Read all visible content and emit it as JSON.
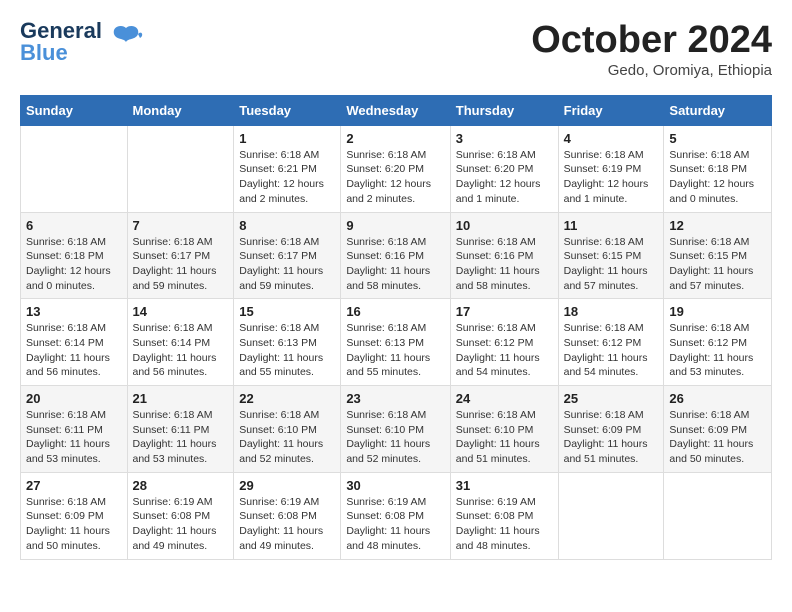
{
  "header": {
    "logo_line1": "General",
    "logo_line2": "Blue",
    "month_title": "October 2024",
    "location": "Gedo, Oromiya, Ethiopia"
  },
  "weekdays": [
    "Sunday",
    "Monday",
    "Tuesday",
    "Wednesday",
    "Thursday",
    "Friday",
    "Saturday"
  ],
  "weeks": [
    [
      {
        "day": "",
        "sunrise": "",
        "sunset": "",
        "daylight": ""
      },
      {
        "day": "",
        "sunrise": "",
        "sunset": "",
        "daylight": ""
      },
      {
        "day": "1",
        "sunrise": "Sunrise: 6:18 AM",
        "sunset": "Sunset: 6:21 PM",
        "daylight": "Daylight: 12 hours and 2 minutes."
      },
      {
        "day": "2",
        "sunrise": "Sunrise: 6:18 AM",
        "sunset": "Sunset: 6:20 PM",
        "daylight": "Daylight: 12 hours and 2 minutes."
      },
      {
        "day": "3",
        "sunrise": "Sunrise: 6:18 AM",
        "sunset": "Sunset: 6:20 PM",
        "daylight": "Daylight: 12 hours and 1 minute."
      },
      {
        "day": "4",
        "sunrise": "Sunrise: 6:18 AM",
        "sunset": "Sunset: 6:19 PM",
        "daylight": "Daylight: 12 hours and 1 minute."
      },
      {
        "day": "5",
        "sunrise": "Sunrise: 6:18 AM",
        "sunset": "Sunset: 6:18 PM",
        "daylight": "Daylight: 12 hours and 0 minutes."
      }
    ],
    [
      {
        "day": "6",
        "sunrise": "Sunrise: 6:18 AM",
        "sunset": "Sunset: 6:18 PM",
        "daylight": "Daylight: 12 hours and 0 minutes."
      },
      {
        "day": "7",
        "sunrise": "Sunrise: 6:18 AM",
        "sunset": "Sunset: 6:17 PM",
        "daylight": "Daylight: 11 hours and 59 minutes."
      },
      {
        "day": "8",
        "sunrise": "Sunrise: 6:18 AM",
        "sunset": "Sunset: 6:17 PM",
        "daylight": "Daylight: 11 hours and 59 minutes."
      },
      {
        "day": "9",
        "sunrise": "Sunrise: 6:18 AM",
        "sunset": "Sunset: 6:16 PM",
        "daylight": "Daylight: 11 hours and 58 minutes."
      },
      {
        "day": "10",
        "sunrise": "Sunrise: 6:18 AM",
        "sunset": "Sunset: 6:16 PM",
        "daylight": "Daylight: 11 hours and 58 minutes."
      },
      {
        "day": "11",
        "sunrise": "Sunrise: 6:18 AM",
        "sunset": "Sunset: 6:15 PM",
        "daylight": "Daylight: 11 hours and 57 minutes."
      },
      {
        "day": "12",
        "sunrise": "Sunrise: 6:18 AM",
        "sunset": "Sunset: 6:15 PM",
        "daylight": "Daylight: 11 hours and 57 minutes."
      }
    ],
    [
      {
        "day": "13",
        "sunrise": "Sunrise: 6:18 AM",
        "sunset": "Sunset: 6:14 PM",
        "daylight": "Daylight: 11 hours and 56 minutes."
      },
      {
        "day": "14",
        "sunrise": "Sunrise: 6:18 AM",
        "sunset": "Sunset: 6:14 PM",
        "daylight": "Daylight: 11 hours and 56 minutes."
      },
      {
        "day": "15",
        "sunrise": "Sunrise: 6:18 AM",
        "sunset": "Sunset: 6:13 PM",
        "daylight": "Daylight: 11 hours and 55 minutes."
      },
      {
        "day": "16",
        "sunrise": "Sunrise: 6:18 AM",
        "sunset": "Sunset: 6:13 PM",
        "daylight": "Daylight: 11 hours and 55 minutes."
      },
      {
        "day": "17",
        "sunrise": "Sunrise: 6:18 AM",
        "sunset": "Sunset: 6:12 PM",
        "daylight": "Daylight: 11 hours and 54 minutes."
      },
      {
        "day": "18",
        "sunrise": "Sunrise: 6:18 AM",
        "sunset": "Sunset: 6:12 PM",
        "daylight": "Daylight: 11 hours and 54 minutes."
      },
      {
        "day": "19",
        "sunrise": "Sunrise: 6:18 AM",
        "sunset": "Sunset: 6:12 PM",
        "daylight": "Daylight: 11 hours and 53 minutes."
      }
    ],
    [
      {
        "day": "20",
        "sunrise": "Sunrise: 6:18 AM",
        "sunset": "Sunset: 6:11 PM",
        "daylight": "Daylight: 11 hours and 53 minutes."
      },
      {
        "day": "21",
        "sunrise": "Sunrise: 6:18 AM",
        "sunset": "Sunset: 6:11 PM",
        "daylight": "Daylight: 11 hours and 53 minutes."
      },
      {
        "day": "22",
        "sunrise": "Sunrise: 6:18 AM",
        "sunset": "Sunset: 6:10 PM",
        "daylight": "Daylight: 11 hours and 52 minutes."
      },
      {
        "day": "23",
        "sunrise": "Sunrise: 6:18 AM",
        "sunset": "Sunset: 6:10 PM",
        "daylight": "Daylight: 11 hours and 52 minutes."
      },
      {
        "day": "24",
        "sunrise": "Sunrise: 6:18 AM",
        "sunset": "Sunset: 6:10 PM",
        "daylight": "Daylight: 11 hours and 51 minutes."
      },
      {
        "day": "25",
        "sunrise": "Sunrise: 6:18 AM",
        "sunset": "Sunset: 6:09 PM",
        "daylight": "Daylight: 11 hours and 51 minutes."
      },
      {
        "day": "26",
        "sunrise": "Sunrise: 6:18 AM",
        "sunset": "Sunset: 6:09 PM",
        "daylight": "Daylight: 11 hours and 50 minutes."
      }
    ],
    [
      {
        "day": "27",
        "sunrise": "Sunrise: 6:18 AM",
        "sunset": "Sunset: 6:09 PM",
        "daylight": "Daylight: 11 hours and 50 minutes."
      },
      {
        "day": "28",
        "sunrise": "Sunrise: 6:19 AM",
        "sunset": "Sunset: 6:08 PM",
        "daylight": "Daylight: 11 hours and 49 minutes."
      },
      {
        "day": "29",
        "sunrise": "Sunrise: 6:19 AM",
        "sunset": "Sunset: 6:08 PM",
        "daylight": "Daylight: 11 hours and 49 minutes."
      },
      {
        "day": "30",
        "sunrise": "Sunrise: 6:19 AM",
        "sunset": "Sunset: 6:08 PM",
        "daylight": "Daylight: 11 hours and 48 minutes."
      },
      {
        "day": "31",
        "sunrise": "Sunrise: 6:19 AM",
        "sunset": "Sunset: 6:08 PM",
        "daylight": "Daylight: 11 hours and 48 minutes."
      },
      {
        "day": "",
        "sunrise": "",
        "sunset": "",
        "daylight": ""
      },
      {
        "day": "",
        "sunrise": "",
        "sunset": "",
        "daylight": ""
      }
    ]
  ]
}
